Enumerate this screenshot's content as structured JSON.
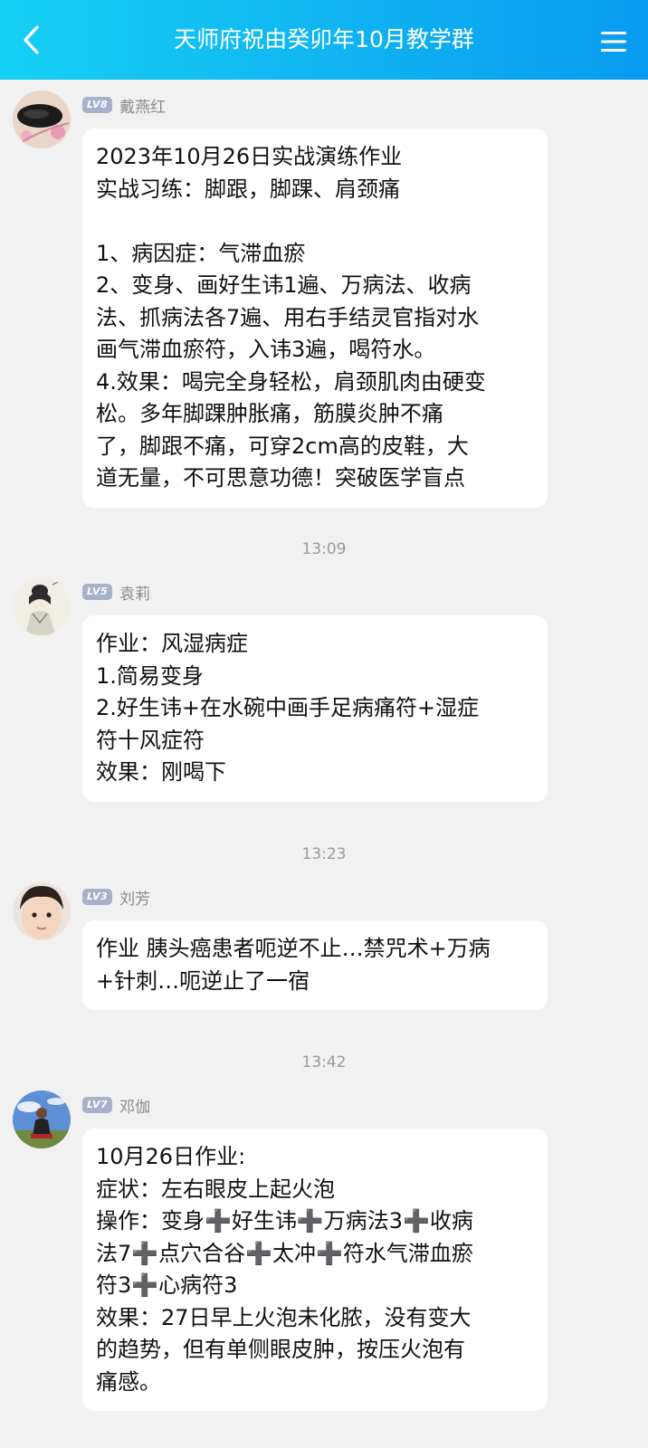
{
  "header": {
    "title": "天师府祝由癸卯年10月教学群",
    "back_icon": "chevron-left-icon",
    "menu_icon": "menu-icon",
    "color_start": "#16d0f3",
    "color_end": "#089bf0"
  },
  "messages": [
    {
      "level": "LV8",
      "name": "戴燕红",
      "lines": [
        "2023年10月26日实战演练作业",
        "实战习练：脚跟，脚踝、肩颈痛",
        "",
        "1、病因症：气滞血瘀",
        "2、变身、画好生讳1遍、万病法、收病",
        "法、抓病法各7遍、用右手结灵官指对水",
        "画气滞血瘀符，入讳3遍，喝符水。",
        "4.效果：喝完全身轻松，肩颈肌肉由硬变",
        "松。多年脚踝肿胀痛，筋膜炎肿不痛",
        "了，脚跟不痛，可穿2cm高的皮鞋，大",
        "道无量，不可思意功德！突破医学盲点"
      ]
    },
    {
      "time": "13:09",
      "level": "LV5",
      "name": "袁莉",
      "lines": [
        "作业：风湿病症",
        "1.简易变身",
        "2.好生讳+在水碗中画手足病痛符+湿症",
        "符十风症符",
        "效果：刚喝下"
      ]
    },
    {
      "time": "13:23",
      "level": "LV3",
      "name": "刘芳",
      "lines": [
        "作业 胰头癌患者呃逆不止…禁咒术+万病",
        "+针刺…呃逆止了一宿"
      ]
    },
    {
      "time": "13:42",
      "level": "LV7",
      "name": "邓伽",
      "lines": [
        "10月26日作业:",
        "症状：左右眼皮上起火泡",
        "操作：变身➕好生讳➕万病法3➕收病",
        "法7➕点穴合谷➕太冲➕符水气滞血瘀",
        "符3➕心病符3",
        "效果：27日早上火泡未化脓，没有变大",
        "的趋势，但有单侧眼皮肿，按压火泡有",
        "痛感。"
      ]
    }
  ]
}
